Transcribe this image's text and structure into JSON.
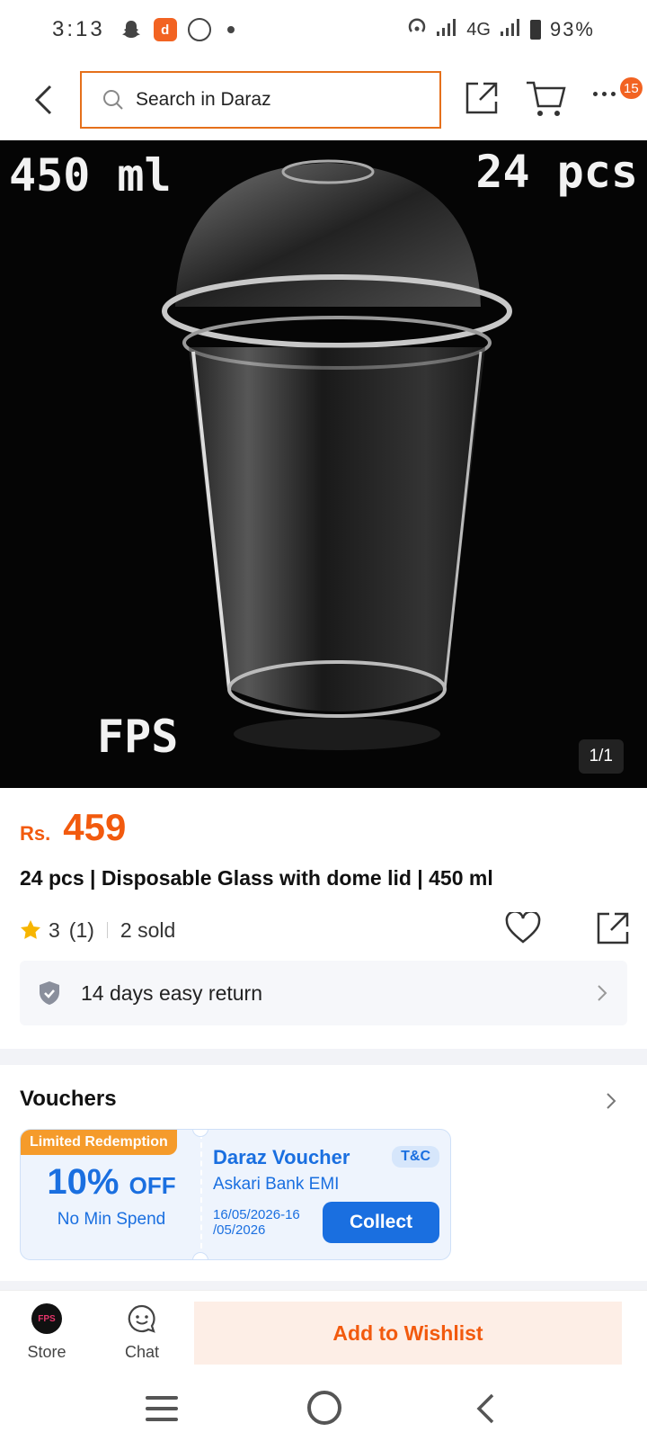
{
  "status_bar": {
    "time": "3:13",
    "network": "4G",
    "battery": "93%"
  },
  "nav": {
    "search_placeholder": "Search in Daraz",
    "cart_badge": "15"
  },
  "image": {
    "text_top_left": "450 ml",
    "text_top_right": "24 pcs",
    "text_bottom_left": "FPS",
    "counter": "1/1"
  },
  "product": {
    "currency": "Rs.",
    "price": "459",
    "title": "24 pcs | Disposable Glass with dome lid | 450 ml",
    "rating": "3",
    "rating_count": "(1)",
    "sold": "2 sold",
    "return_policy": "14 days easy return"
  },
  "vouchers": {
    "title": "Vouchers",
    "tag": "Limited Redemption",
    "discount": "10%",
    "discount_suffix": "OFF",
    "min_spend": "No Min Spend",
    "name": "Daraz Voucher",
    "tc": "T&C",
    "bank": "Askari Bank EMI",
    "date_range": "16/05/2026-16 /05/2026",
    "collect": "Collect"
  },
  "action_bar": {
    "store_logo": "FPS",
    "store": "Store",
    "chat": "Chat",
    "wishlist": "Add to Wishlist"
  },
  "colors": {
    "brand_orange": "#f25a0e",
    "voucher_blue": "#1a6fe0",
    "tag_orange": "#f59b2b"
  }
}
